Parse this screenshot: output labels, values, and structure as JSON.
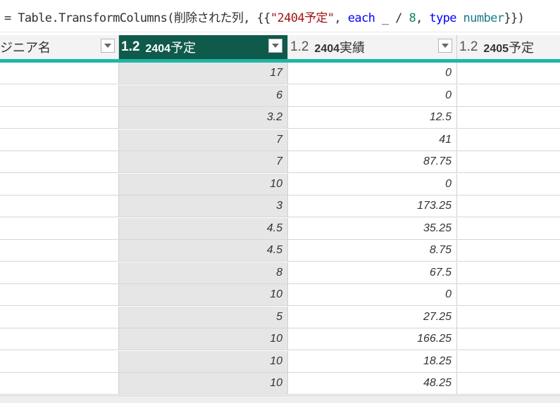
{
  "formula": {
    "prefix": "= Table.TransformColumns(削除された列, {{",
    "string_literal": "\"2404予定\"",
    "sep1": ", ",
    "keyword_each": "each",
    "middle": " _ / ",
    "number_literal": "8",
    "sep2": ", ",
    "keyword_type": "type",
    "space": " ",
    "type_name": "number",
    "suffix": "}})"
  },
  "columns": [
    {
      "label": "ジニア名",
      "type_icon": ""
    },
    {
      "label_bold": "2404",
      "label_rest": "予定",
      "type_icon": "1.2"
    },
    {
      "label_bold": "2404",
      "label_rest": "実績",
      "type_icon": "1.2"
    },
    {
      "label_bold": "2405",
      "label_rest": "予定",
      "type_icon": "1.2"
    }
  ],
  "rows": [
    {
      "plan": "17",
      "actual": "0"
    },
    {
      "plan": "6",
      "actual": "0"
    },
    {
      "plan": "3.2",
      "actual": "12.5"
    },
    {
      "plan": "7",
      "actual": "41"
    },
    {
      "plan": "7",
      "actual": "87.75"
    },
    {
      "plan": "10",
      "actual": "0"
    },
    {
      "plan": "3",
      "actual": "173.25"
    },
    {
      "plan": "4.5",
      "actual": "35.25"
    },
    {
      "plan": "4.5",
      "actual": "8.75"
    },
    {
      "plan": "8",
      "actual": "67.5"
    },
    {
      "plan": "10",
      "actual": "0"
    },
    {
      "plan": "5",
      "actual": "27.25"
    },
    {
      "plan": "10",
      "actual": "166.25"
    },
    {
      "plan": "10",
      "actual": "18.25"
    },
    {
      "plan": "10",
      "actual": "48.25"
    }
  ],
  "colors": {
    "selected_header": "#0f5a4b",
    "quality_bar": "#1fb5a6",
    "selected_column": "#e6e6e6"
  },
  "icons": {
    "dropdown": "chevron-down-icon"
  }
}
